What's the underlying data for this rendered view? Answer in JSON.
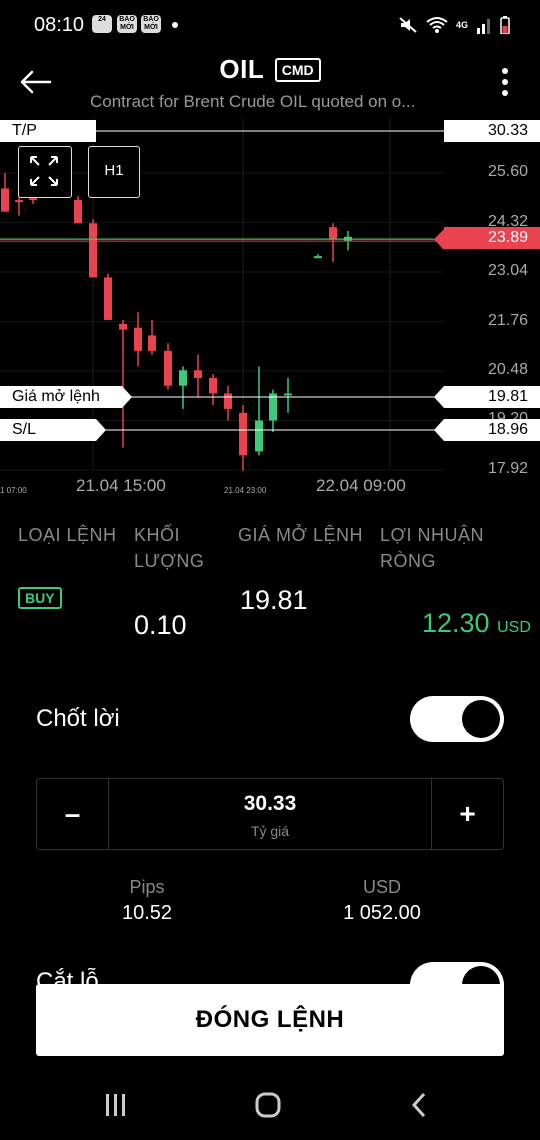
{
  "status_bar": {
    "time": "08:10",
    "badges": [
      "24",
      "BÁO MỚI",
      "BÁO MỚI"
    ],
    "network": "4G"
  },
  "header": {
    "title": "OIL",
    "badge": "CMD",
    "subtitle": "Contract for Brent Crude OIL quoted on o..."
  },
  "chart": {
    "timeframe": "H1",
    "tp_label": "T/P",
    "tp_price": "30.33",
    "current_price": "23.89",
    "open_label": "Giá mở lệnh",
    "open_price": "19.81",
    "sl_label": "S/L",
    "sl_price": "18.96",
    "axis_values": [
      "25.60",
      "24.32",
      "23.04",
      "21.76",
      "20.48",
      "19.20",
      "17.92"
    ],
    "x_ticks": [
      "21.04 15:00",
      "22.04 09:00"
    ],
    "x_ticks_small": [
      "1 07:00",
      "21.04 23:00"
    ]
  },
  "chart_data": {
    "type": "candlestick",
    "series": [
      {
        "o": 25.2,
        "h": 25.6,
        "l": 24.8,
        "c": 24.6
      },
      {
        "o": 24.9,
        "h": 25.1,
        "l": 24.5,
        "c": 24.85
      },
      {
        "o": 24.95,
        "h": 25.0,
        "l": 24.8,
        "c": 24.9
      },
      {
        "o": 24.9,
        "h": 25.0,
        "l": 24.3,
        "c": 24.3
      },
      {
        "o": 24.3,
        "h": 24.4,
        "l": 22.9,
        "c": 22.9
      },
      {
        "o": 22.9,
        "h": 23.0,
        "l": 21.8,
        "c": 21.8
      },
      {
        "o": 21.7,
        "h": 21.8,
        "l": 18.5,
        "c": 21.55
      },
      {
        "o": 21.6,
        "h": 22.0,
        "l": 20.6,
        "c": 21.0
      },
      {
        "o": 21.4,
        "h": 21.8,
        "l": 20.9,
        "c": 21.0
      },
      {
        "o": 21.0,
        "h": 21.2,
        "l": 20.0,
        "c": 20.1
      },
      {
        "o": 20.1,
        "h": 20.6,
        "l": 19.5,
        "c": 20.5
      },
      {
        "o": 20.5,
        "h": 20.9,
        "l": 19.8,
        "c": 20.3
      },
      {
        "o": 20.3,
        "h": 20.4,
        "l": 19.6,
        "c": 19.9
      },
      {
        "o": 19.9,
        "h": 20.1,
        "l": 19.2,
        "c": 19.5
      },
      {
        "o": 19.4,
        "h": 19.6,
        "l": 17.9,
        "c": 18.3
      },
      {
        "o": 18.4,
        "h": 20.6,
        "l": 18.3,
        "c": 19.2
      },
      {
        "o": 19.2,
        "h": 20.0,
        "l": 18.9,
        "c": 19.9
      },
      {
        "o": 19.9,
        "h": 20.3,
        "l": 19.4,
        "c": 19.9
      },
      {
        "o": 23.4,
        "h": 23.5,
        "l": 23.4,
        "c": 23.45
      },
      {
        "o": 24.2,
        "h": 24.3,
        "l": 23.3,
        "c": 23.9
      },
      {
        "o": 23.85,
        "h": 24.1,
        "l": 23.6,
        "c": 23.95
      }
    ]
  },
  "order": {
    "col_type": "LOẠI LỆNH",
    "col_volume": "KHỐI LƯỢNG",
    "col_open": "GIÁ MỞ LỆNH",
    "col_pnl": "LỢI NHUẬN RÒNG",
    "type": "BUY",
    "volume": "0.10",
    "open_price": "19.81",
    "pnl": "12.30",
    "pnl_unit": "USD"
  },
  "take_profit": {
    "label": "Chốt lời",
    "minus": "–",
    "plus": "+",
    "value": "30.33",
    "caption": "Tỷ giá",
    "pips_label": "Pips",
    "pips_value": "10.52",
    "usd_label": "USD",
    "usd_value": "1 052.00"
  },
  "stop_loss": {
    "label": "Cắt lỗ"
  },
  "close_button": "ĐÓNG LỆNH",
  "colors": {
    "green": "#3cc97a",
    "red": "#e8434f"
  }
}
